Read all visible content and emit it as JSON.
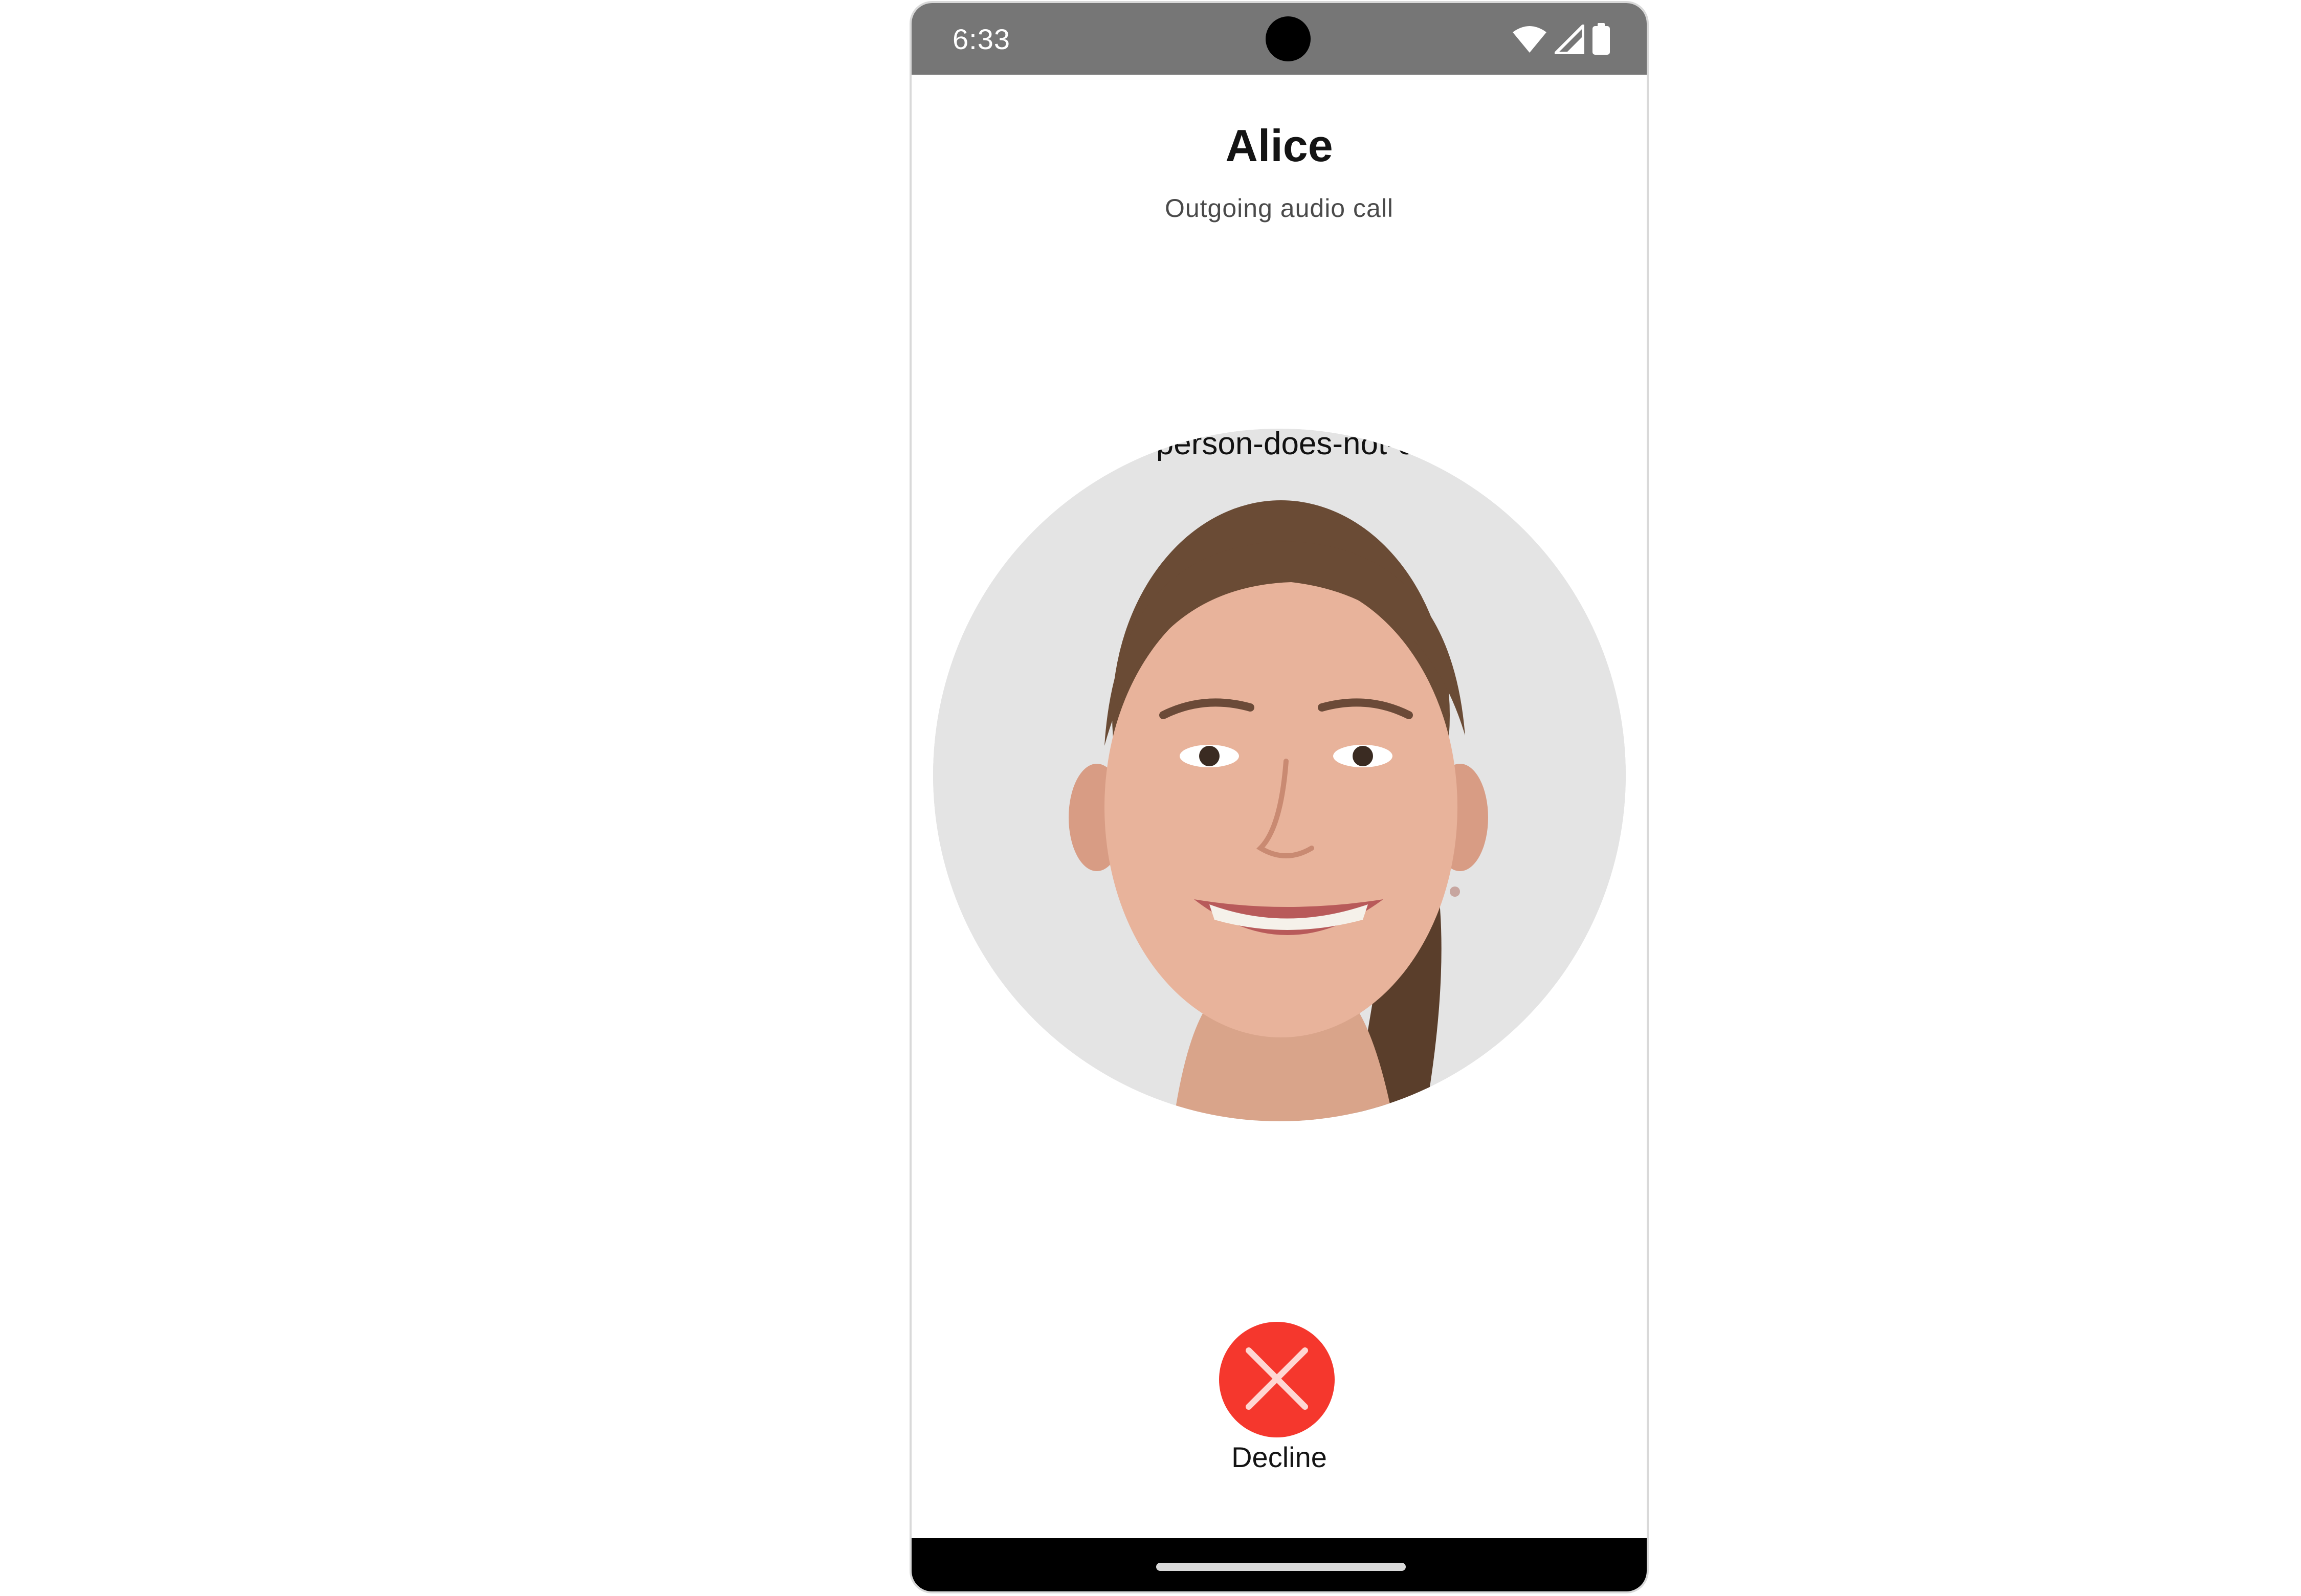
{
  "status_bar": {
    "time": "6:33",
    "icons": [
      "wifi-icon",
      "cellular-signal-icon",
      "battery-icon"
    ],
    "background": "#767676"
  },
  "call": {
    "caller_name": "Alice",
    "status": "Outgoing audio call",
    "avatar_alt_text": "this-person-does-not-exist"
  },
  "actions": {
    "decline_label": "Decline",
    "decline_color": "#f5372d",
    "decline_icon": "close-icon"
  },
  "nav_bar": {
    "background": "#000000"
  }
}
